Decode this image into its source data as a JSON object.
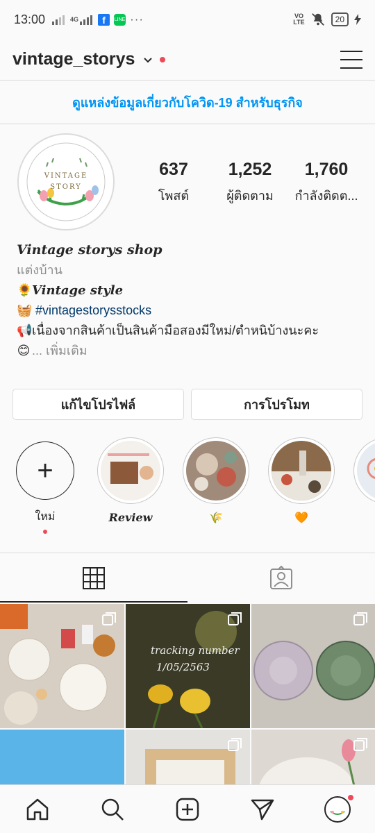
{
  "status_bar": {
    "time": "13:00",
    "network_type": "4G",
    "volte_top": "VO",
    "volte_bottom": "LTE",
    "battery": "20",
    "notification_icons": [
      "facebook-icon",
      "line-icon",
      "more-dots-icon"
    ]
  },
  "header": {
    "username": "vintage_storys",
    "has_notification_dot": true
  },
  "covid_banner": {
    "text": "ดูแหล่งข้อมูลเกี่ยวกับโควิด-19 สำหรับธุรกิจ",
    "color": "#0095f6"
  },
  "profile": {
    "avatar_text_line1": "VINTAGE",
    "avatar_text_line2": "STORY",
    "stats": [
      {
        "value": "637",
        "label": "โพสต์"
      },
      {
        "value": "1,252",
        "label": "ผู้ติดตาม"
      },
      {
        "value": "1,760",
        "label": "กำลังติดต..."
      }
    ]
  },
  "bio": {
    "name": "Vintage storys shop",
    "category": "แต่งบ้าน",
    "line1_emoji": "🌻",
    "line1_text": "Vintage style",
    "line2_emoji": "🧺",
    "line2_hashtag": "#vintagestorysstocks",
    "line3_emoji": "📢",
    "line3_text": "เนื่องจากสินค้าเป็นสินค้ามือสองมีใหม่/ตำหนิบ้างนะคะ",
    "line4_emoji": "😊",
    "more_text": "... เพิ่มเติม"
  },
  "buttons": {
    "edit_profile": "แก้ไขโปรไฟล์",
    "promotions": "การโปรโมท"
  },
  "highlights": [
    {
      "label": "ใหม่",
      "type": "new"
    },
    {
      "label": "Review",
      "type": "story"
    },
    {
      "label": "🌾",
      "type": "story"
    },
    {
      "label": "🧡",
      "type": "story"
    },
    {
      "label": "",
      "type": "story"
    }
  ],
  "tabs": {
    "active": "grid"
  },
  "colors": {
    "accent": "#0095f6",
    "notification": "#ed4956",
    "text": "#262626",
    "muted": "#8e8e8e",
    "hashtag": "#00376b"
  }
}
